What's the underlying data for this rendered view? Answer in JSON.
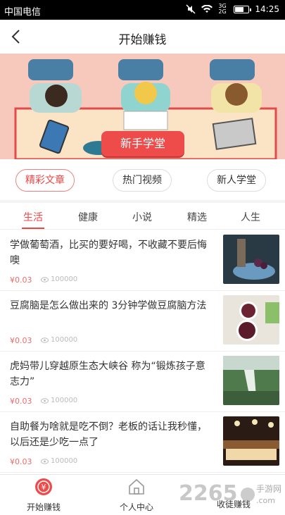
{
  "statusbar": {
    "carrier": "中国电信",
    "network": "3G 2G",
    "time": "14:25"
  },
  "navbar": {
    "title": "开始赚钱"
  },
  "banner": {
    "button": "新手学堂"
  },
  "categories": [
    "精彩文章",
    "热门视频",
    "新人学堂"
  ],
  "tabs": [
    "生活",
    "健康",
    "小说",
    "精选",
    "人生"
  ],
  "articles": [
    {
      "title": "学做葡萄酒，比买的要好喝，不收藏不要后悔噢",
      "price": "¥0.03",
      "views": "100000"
    },
    {
      "title": "豆腐脑是怎么做出来的 3分钟学做豆腐脑方法",
      "price": "¥0.03",
      "views": "100000"
    },
    {
      "title": "虎妈带儿穿越原生态大峡谷 称为“锻炼孩子意志力”",
      "price": "¥0.03",
      "views": "100000"
    },
    {
      "title": "自助餐为啥就是吃不倒？老板的话让我秒懂，以后还是少吃一点了",
      "price": "¥0.03",
      "views": "100000"
    }
  ],
  "bottom": {
    "earn": "开始赚钱",
    "profile": "个人中心",
    "apprentice": "收徒赚钱"
  },
  "watermark": {
    "brand": "2265",
    "site": "手游网",
    "domain": ".com"
  },
  "colors": {
    "accent": "#ee4b4b",
    "banner_bg": "#f7c9bd"
  }
}
